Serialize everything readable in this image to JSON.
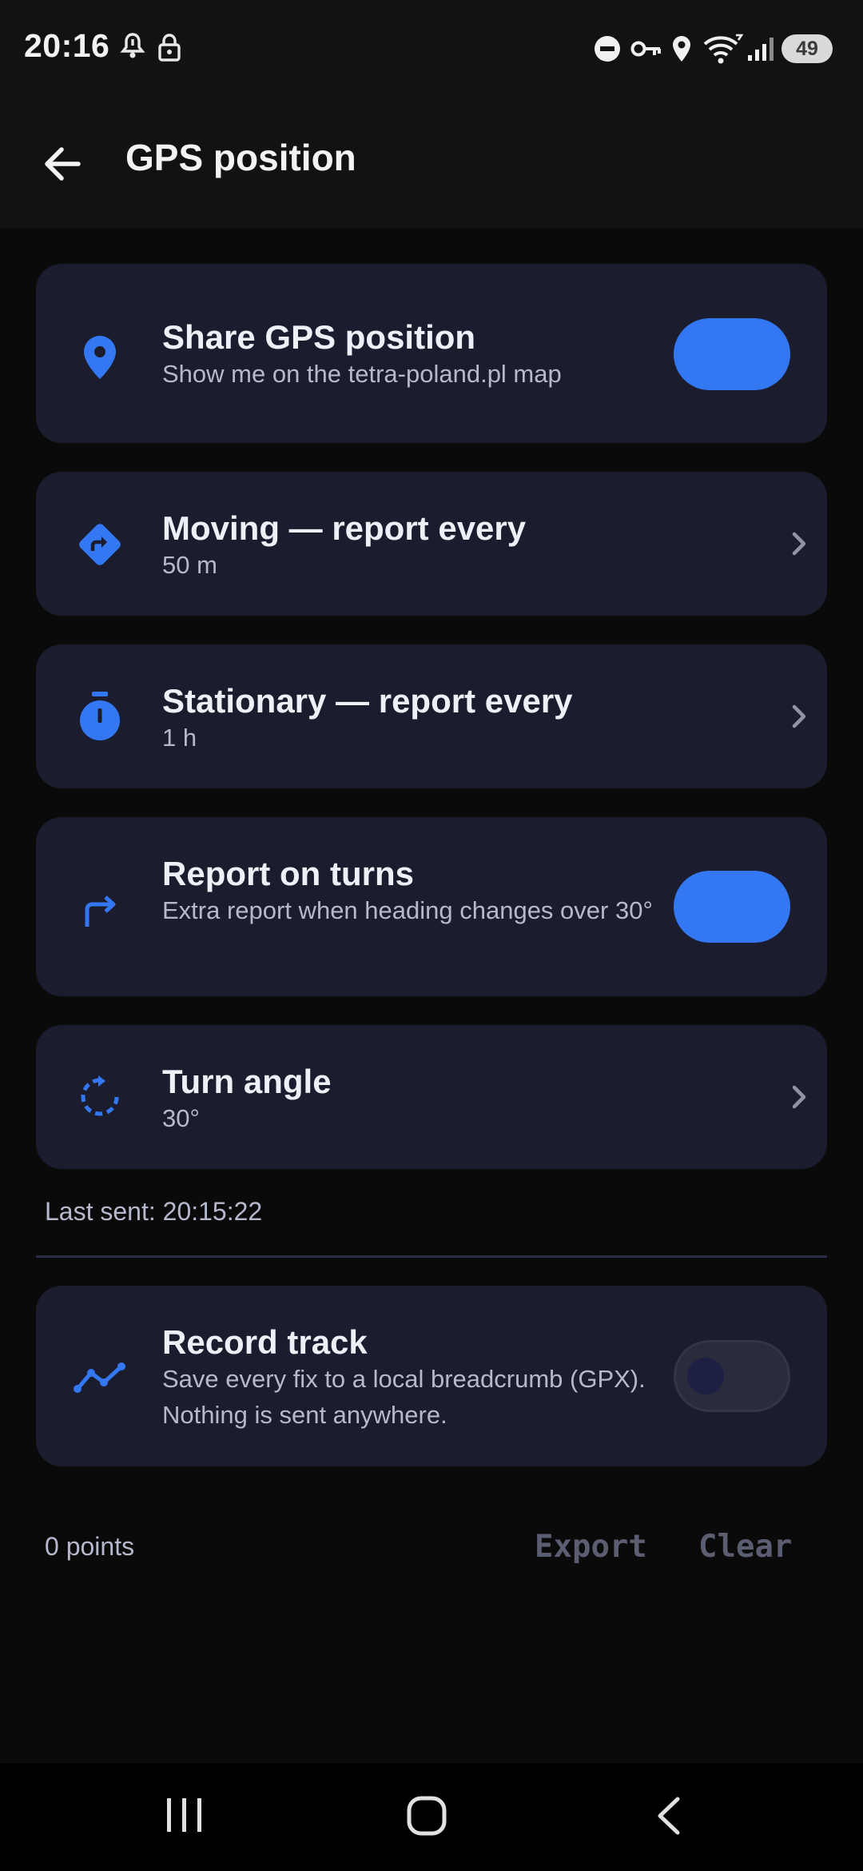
{
  "status_bar": {
    "time": "20:16",
    "battery": "49",
    "icons": [
      "notification-bell-icon",
      "lock-icon",
      "do-not-disturb-icon",
      "vpn-key-icon",
      "location-icon",
      "wifi-icon",
      "signal-icon"
    ]
  },
  "app_bar": {
    "title": "GPS position",
    "back_icon": "arrow-back-icon"
  },
  "settings": [
    {
      "icon": "location-pin-icon",
      "title": "Share GPS position",
      "subtitle": "Show me on the tetra-poland.pl map",
      "control": "toggle",
      "on": true
    },
    {
      "icon": "directions-icon",
      "title": "Moving — report every",
      "subtitle": "50 m",
      "control": "chevron"
    },
    {
      "icon": "timer-icon",
      "title": "Stationary — report every",
      "subtitle": "1 h",
      "control": "chevron"
    },
    {
      "icon": "turn-right-icon",
      "title": "Report on turns",
      "subtitle": "Extra report when heading changes over 30°",
      "control": "toggle",
      "on": true
    },
    {
      "icon": "rotate-icon",
      "title": "Turn angle",
      "subtitle": "30°",
      "control": "chevron"
    }
  ],
  "last_sent": "Last sent: 20:15:22",
  "record_track": {
    "icon": "timeline-icon",
    "title": "Record track",
    "subtitle": "Save every fix to a local breadcrumb (GPX). Nothing is sent anywhere.",
    "on": false
  },
  "track_footer": {
    "points": "0 points",
    "export_label": "Export",
    "clear_label": "Clear"
  },
  "nav_bar": {
    "icons": [
      "recent-apps-icon",
      "home-icon",
      "back-icon"
    ]
  },
  "colors": {
    "accent": "#3378f2",
    "card": "#1b1c2d",
    "background": "#0a0a0b"
  }
}
